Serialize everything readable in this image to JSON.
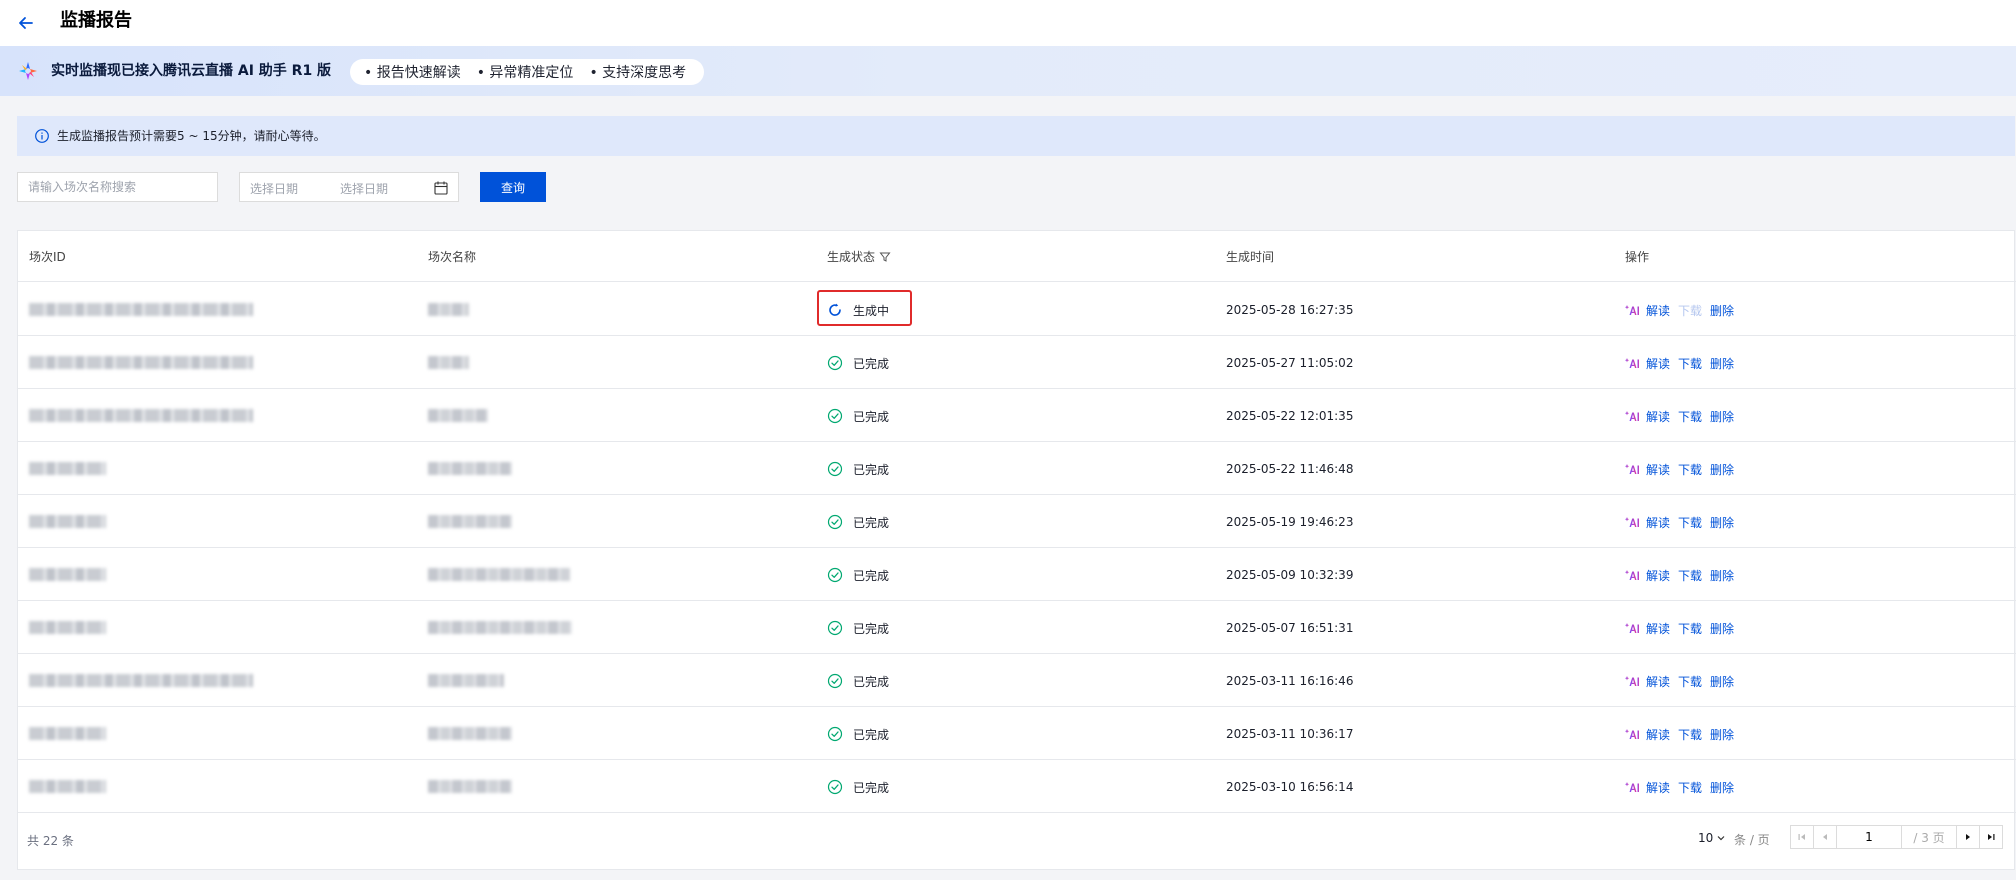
{
  "header": {
    "title": "监播报告"
  },
  "promo": {
    "text": "实时监播现已接入腾讯云直播 AI 助手 R1 版",
    "tags": [
      "• 报告快速解读",
      "• 异常精准定位",
      "• 支持深度思考"
    ]
  },
  "notice": {
    "text": "生成监播报告预计需要5 ~ 15分钟，请耐心等待。"
  },
  "filters": {
    "search_placeholder": "请输入场次名称搜索",
    "date_start_placeholder": "选择日期",
    "date_end_placeholder": "选择日期",
    "query_label": "查询"
  },
  "table": {
    "columns": [
      "场次ID",
      "场次名称",
      "生成状态",
      "生成时间",
      "操作"
    ],
    "rows": [
      {
        "status": "生成中",
        "time": "2025-05-28 16:27:35"
      },
      {
        "status": "已完成",
        "time": "2025-05-27 11:05:02"
      },
      {
        "status": "已完成",
        "time": "2025-05-22 12:01:35"
      },
      {
        "status": "已完成",
        "time": "2025-05-22 11:46:48"
      },
      {
        "status": "已完成",
        "time": "2025-05-19 19:46:23"
      },
      {
        "status": "已完成",
        "time": "2025-05-09 10:32:39"
      },
      {
        "status": "已完成",
        "time": "2025-05-07 16:51:31"
      },
      {
        "status": "已完成",
        "time": "2025-03-11 16:16:46"
      },
      {
        "status": "已完成",
        "time": "2025-03-11 10:36:17"
      },
      {
        "status": "已完成",
        "time": "2025-03-10 16:56:14"
      }
    ],
    "actions": {
      "interpret": "解读",
      "download": "下载",
      "delete": "删除"
    }
  },
  "pagination": {
    "total": "共 22 条",
    "page_size": "10",
    "per_page_label": "条 / 页",
    "current_page": "1",
    "total_pages": "/ 3 页"
  },
  "colors": {
    "primary": "#0052d9",
    "success": "#00a870",
    "highlight": "#e02b2b"
  }
}
